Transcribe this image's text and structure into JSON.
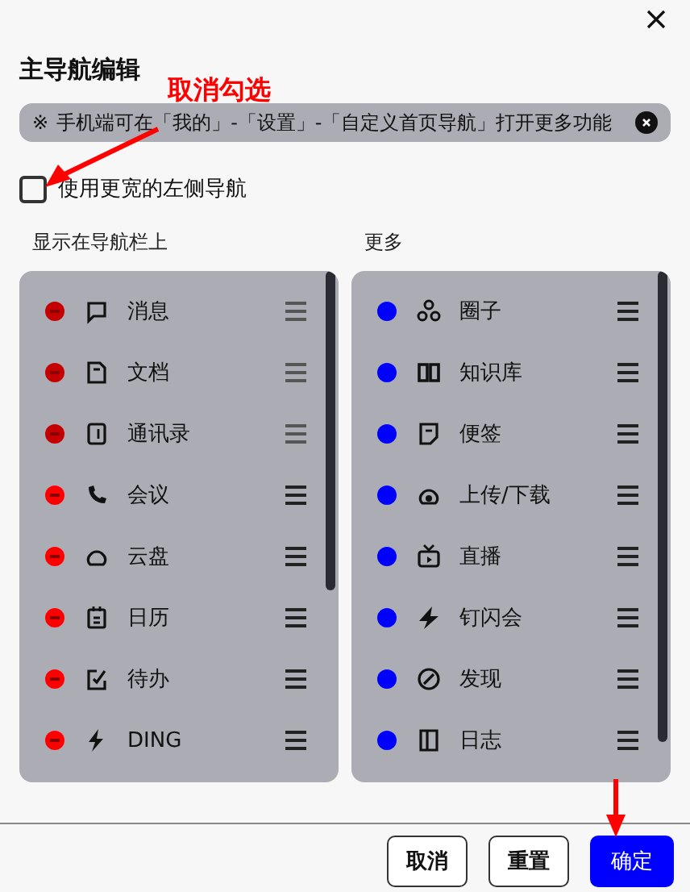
{
  "dialog": {
    "title": "主导航编辑"
  },
  "notice": {
    "icon": "※",
    "text": "手机端可在「我的」-「设置」-「自定义首页导航」打开更多功能"
  },
  "option": {
    "label": "使用更宽的左侧导航",
    "checked": false
  },
  "annotations": [
    {
      "text": "取消勾选"
    }
  ],
  "columns": [
    {
      "heading": "显示在导航栏上",
      "kind": "remove",
      "items": [
        {
          "label": "消息",
          "color": "#c40000",
          "disabled": true
        },
        {
          "label": "文档",
          "color": "#c40000",
          "disabled": true
        },
        {
          "label": "通讯录",
          "color": "#c40000",
          "disabled": true
        },
        {
          "label": "会议",
          "color": "#ff0000",
          "disabled": false
        },
        {
          "label": "云盘",
          "color": "#ff0000",
          "disabled": false
        },
        {
          "label": "日历",
          "color": "#ff0000",
          "disabled": false
        },
        {
          "label": "待办",
          "color": "#ff0000",
          "disabled": false
        },
        {
          "label": "DING",
          "color": "#ff0000",
          "disabled": false
        }
      ]
    },
    {
      "heading": "更多",
      "kind": "add",
      "items": [
        {
          "label": "圈子",
          "color": "#0000ff",
          "disabled": false
        },
        {
          "label": "知识库",
          "color": "#0000ff",
          "disabled": false
        },
        {
          "label": "便签",
          "color": "#0000ff",
          "disabled": false
        },
        {
          "label": "上传/下载",
          "color": "#0000ff",
          "disabled": false
        },
        {
          "label": "直播",
          "color": "#0000ff",
          "disabled": false
        },
        {
          "label": "钉闪会",
          "color": "#0000ff",
          "disabled": false
        },
        {
          "label": "发现",
          "color": "#0000ff",
          "disabled": false
        },
        {
          "label": "日志",
          "color": "#0000ff",
          "disabled": false
        }
      ]
    }
  ],
  "buttons": [
    {
      "label": "取消",
      "kind": "secondary"
    },
    {
      "label": "重置",
      "kind": "secondary"
    },
    {
      "label": "确定",
      "kind": "primary"
    }
  ]
}
